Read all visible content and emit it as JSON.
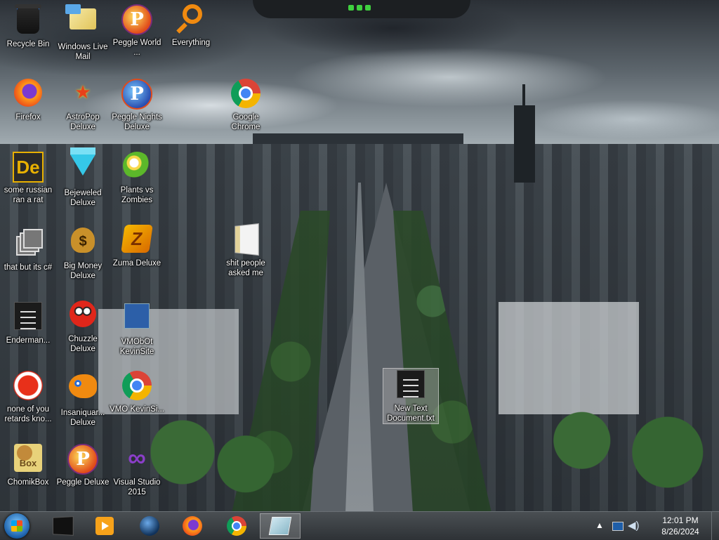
{
  "desktop": {
    "icons": [
      {
        "id": "recycle-bin",
        "label": "Recycle Bin"
      },
      {
        "id": "windows-live-mail",
        "label": "Windows Live Mail"
      },
      {
        "id": "peggle-world",
        "label": "Peggle World ..."
      },
      {
        "id": "everything",
        "label": "Everything"
      },
      {
        "id": "firefox",
        "label": "Firefox"
      },
      {
        "id": "astropop-deluxe",
        "label": "AstroPop Deluxe"
      },
      {
        "id": "peggle-nights-deluxe",
        "label": "Peggle Nights Deluxe"
      },
      {
        "id": "google-chrome",
        "label": "Google Chrome"
      },
      {
        "id": "some-russian-ran-a-rat",
        "label": "some russian ran a rat"
      },
      {
        "id": "bejeweled-deluxe",
        "label": "Bejeweled Deluxe"
      },
      {
        "id": "plants-vs-zombies",
        "label": "Plants vs Zombies"
      },
      {
        "id": "that-but-its-csharp",
        "label": "that but its c#"
      },
      {
        "id": "big-money-deluxe",
        "label": "Big Money Deluxe"
      },
      {
        "id": "zuma-deluxe",
        "label": "Zuma Deluxe"
      },
      {
        "id": "shit-people-asked-me",
        "label": "shit people asked me"
      },
      {
        "id": "enderman",
        "label": "Enderman..."
      },
      {
        "id": "chuzzle-deluxe",
        "label": "Chuzzle Deluxe"
      },
      {
        "id": "vmobot-kevinsite",
        "label": "VMObOt KevinSite"
      },
      {
        "id": "new-text-document",
        "label": "New Text Document.txt"
      },
      {
        "id": "none-of-you-retards",
        "label": "none of you retards kno..."
      },
      {
        "id": "insaniquarium-deluxe",
        "label": "Insaniquar... Deluxe"
      },
      {
        "id": "vmo-kevinsi",
        "label": "VMO KevinSi..."
      },
      {
        "id": "chomikbox",
        "label": "ChomikBox"
      },
      {
        "id": "peggle-deluxe",
        "label": "Peggle Deluxe"
      },
      {
        "id": "visual-studio-2015",
        "label": "Visual Studio 2015"
      }
    ]
  },
  "glyphs": {
    "astropop": "★",
    "de": "De",
    "peggle": "P",
    "big_money": "$",
    "zuma": "Z",
    "box": "Box",
    "vs": "∞"
  },
  "taskbar": {
    "items": [
      {
        "id": "command-prompt",
        "icon": "console-icon"
      },
      {
        "id": "media-player",
        "icon": "media-player-icon"
      },
      {
        "id": "globe-app",
        "icon": "globe-icon"
      },
      {
        "id": "firefox",
        "icon": "firefox-icon"
      },
      {
        "id": "chrome",
        "icon": "chrome-icon"
      },
      {
        "id": "notepad",
        "icon": "notepad-icon",
        "active": true
      }
    ],
    "tray": {
      "arrow": "▲",
      "speaker": "◀)"
    },
    "clock": {
      "time": "12:01 PM",
      "date": "8/26/2024"
    }
  },
  "colors": {
    "accent": "#3fd03f",
    "taskbar": "#2e3236",
    "selection": "#aaaaaa"
  }
}
